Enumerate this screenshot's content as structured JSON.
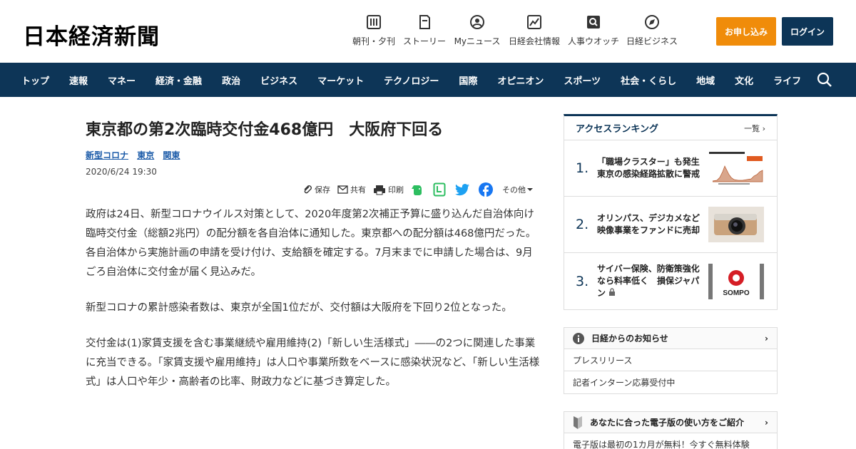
{
  "header": {
    "logo": "日本経済新聞",
    "nav": [
      {
        "label": "朝刊・夕刊",
        "icon": "newspaper-icon"
      },
      {
        "label": "ストーリー",
        "icon": "book-icon"
      },
      {
        "label": "Myニュース",
        "icon": "person-icon"
      },
      {
        "label": "日経会社情報",
        "icon": "chart-icon"
      },
      {
        "label": "人事ウオッチ",
        "icon": "magnifier-icon"
      },
      {
        "label": "日経ビジネス",
        "icon": "compass-icon"
      }
    ],
    "apply_label": "お申し込み",
    "login_label": "ログイン"
  },
  "navbar": {
    "items": [
      "トップ",
      "速報",
      "マネー",
      "経済・金融",
      "政治",
      "ビジネス",
      "マーケット",
      "テクノロジー",
      "国際",
      "オピニオン",
      "スポーツ",
      "社会・くらし",
      "地域",
      "文化",
      "ライフ"
    ]
  },
  "article": {
    "title": "東京都の第2次臨時交付金468億円　大阪府下回る",
    "tags": [
      "新型コロナ",
      "東京",
      "関東"
    ],
    "date": "2020/6/24 19:30",
    "share": {
      "save": "保存",
      "share": "共有",
      "print": "印刷",
      "other": "その他"
    },
    "paragraphs": [
      "政府は24日、新型コロナウイルス対策として、2020年度第2次補正予算に盛り込んだ自治体向け臨時交付金（総額2兆円）の配分額を各自治体に通知した。東京都への配分額は468億円だった。各自治体から実施計画の申請を受け付け、支給額を確定する。7月末までに申請した場合は、9月ごろ自治体に交付金が届く見込みだ。",
      "新型コロナの累計感染者数は、東京が全国1位だが、交付額は大阪府を下回り2位となった。",
      "交付金は(1)家賃支援を含む事業継続や雇用維持(2)「新しい生活様式」――の2つに関連した事業に充当できる。「家賃支援や雇用維持」は人口や事業所数をベースに感染状況など、「新しい生活様式」は人口や年少・高齢者の比率、財政力などに基づき算定した。"
    ]
  },
  "sidebar": {
    "ranking": {
      "title": "アクセスランキング",
      "more": "一覧",
      "items": [
        {
          "rank": "1.",
          "title": "「職場クラスター」も発生　東京の感染経路拡散に警戒",
          "thumb": "chart-thumbnail"
        },
        {
          "rank": "2.",
          "title": "オリンパス、デジカメなど映像事業をファンドに売却",
          "thumb": "camera-thumbnail"
        },
        {
          "rank": "3.",
          "title": "サイバー保険、防衛策強化なら料率低く　損保ジャパン",
          "thumb": "sompo-thumbnail",
          "locked": true,
          "logo_text": "SOMPO"
        }
      ]
    },
    "notice": {
      "title": "日経からのお知らせ",
      "items": [
        "プレスリリース",
        "記者インターン応募受付中"
      ]
    },
    "guide": {
      "title": "あなたに合った電子版の使い方をご紹介",
      "items": [
        "電子版は最初の1カ月が無料！今すぐ無料体験"
      ]
    }
  },
  "colors": {
    "brand_navy": "#0d3557",
    "apply_orange": "#f08c0a",
    "link_blue": "#1a5aa8",
    "evernote_green": "#2dbe60",
    "twitter_blue": "#1da1f2",
    "facebook_blue": "#1877f2"
  }
}
